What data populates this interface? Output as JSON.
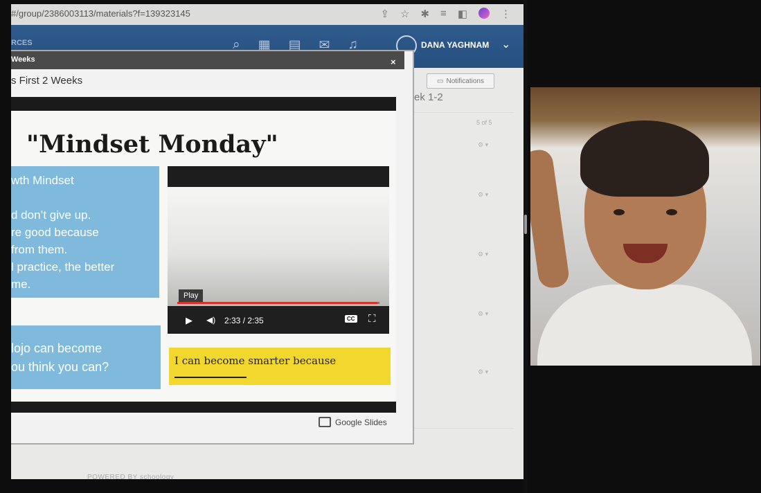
{
  "browser": {
    "url": "#/group/2386003113/materials?f=139323145",
    "icons": [
      "share-icon",
      "star-icon",
      "extensions-icon",
      "reading-list-icon",
      "sidebar-icon",
      "profile-icon",
      "more-icon"
    ]
  },
  "topnav": {
    "brand": "RCES",
    "icons": [
      "search-icon",
      "apps-grid-icon",
      "calendar-icon",
      "mail-icon",
      "bell-icon"
    ],
    "user_name": "DANA YAGHNAM",
    "accent": "#2b5889"
  },
  "modal": {
    "header_title": "Weeks",
    "close_label": "×",
    "page_title": "s First 2 Weeks"
  },
  "right_panel": {
    "notifications_label": "Notifications",
    "week_title": "ek 1-2",
    "count": "5 of 5",
    "row_controls": [
      "⚙ ▾",
      "⚙ ▾",
      "⚙ ▾",
      "⚙ ▾",
      "⚙ ▾"
    ]
  },
  "slide": {
    "title": "\"Mindset Monday\"",
    "box1_lines": [
      "wth Mindset",
      "",
      "d don’t give up.",
      "re good because",
      "from them.",
      "l practice, the better",
      "me."
    ],
    "box2_lines": [
      "lojo can become",
      "ou think you can?"
    ],
    "prompt": "I can become smarter because",
    "prompt_blank": "_________."
  },
  "video": {
    "tooltip": "Play",
    "time": "2:33 / 2:35",
    "cc_label": "CC",
    "progress": 0.99
  },
  "embed_brand": "Google Slides",
  "footer": "POWERED BY schoology"
}
